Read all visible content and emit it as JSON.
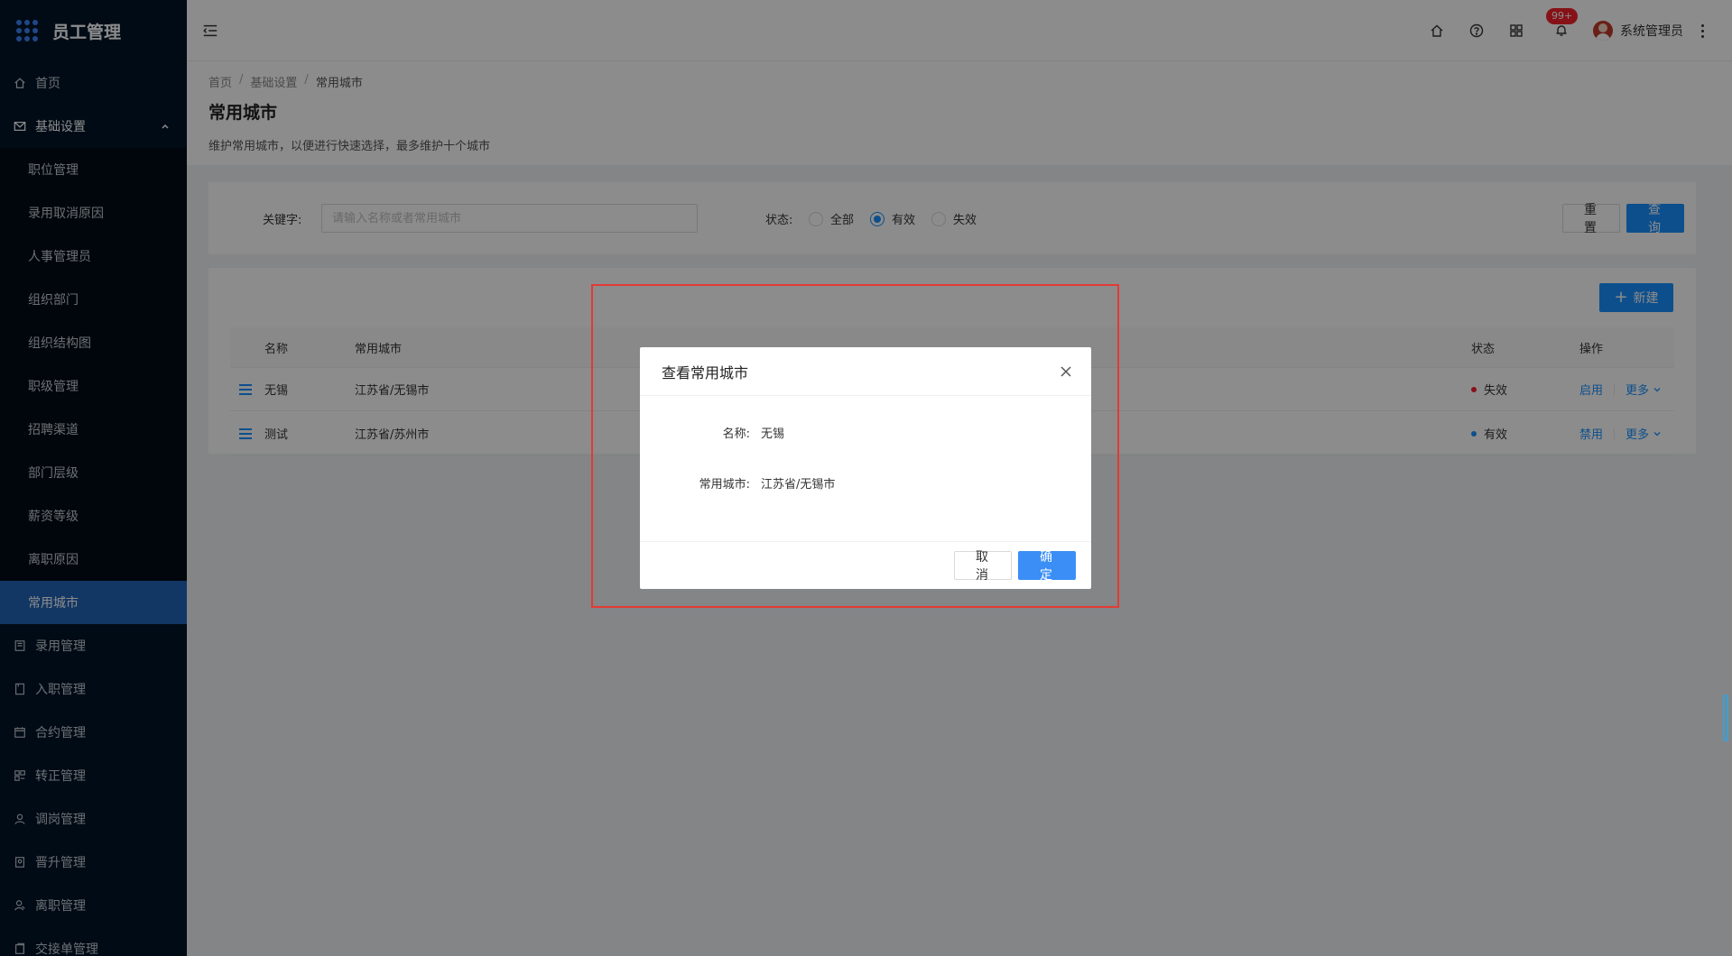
{
  "app": {
    "title": "员工管理"
  },
  "sidebar": {
    "home": "首页",
    "basic_settings": "基础设置",
    "sub_items": [
      "职位管理",
      "录用取消原因",
      "人事管理员",
      "组织部门",
      "组织结构图",
      "职级管理",
      "招聘渠道",
      "部门层级",
      "薪资等级",
      "离职原因",
      "常用城市"
    ],
    "active_sub": "常用城市",
    "bottom_items": [
      "录用管理",
      "入职管理",
      "合约管理",
      "转正管理",
      "调岗管理",
      "晋升管理",
      "离职管理",
      "交接单管理"
    ]
  },
  "header": {
    "notification_badge": "99+",
    "user_name": "系统管理员"
  },
  "breadcrumb": [
    "首页",
    "基础设置",
    "常用城市"
  ],
  "page": {
    "title": "常用城市",
    "description": "维护常用城市，以便进行快速选择，最多维护十个城市"
  },
  "filter": {
    "keyword_label": "关键字:",
    "keyword_placeholder": "请输入名称或者常用城市",
    "keyword_value": "",
    "status_label": "状态:",
    "status_options": [
      "全部",
      "有效",
      "失效"
    ],
    "status_selected": "有效",
    "reset_label": "重置",
    "query_label": "查询"
  },
  "table": {
    "new_label": "新建",
    "columns": [
      "名称",
      "常用城市",
      "状态",
      "操作"
    ],
    "rows": [
      {
        "name": "无锡",
        "city": "江苏省/无锡市",
        "status": "失效",
        "status_color": "#f5222d",
        "op": "启用",
        "more": "更多"
      },
      {
        "name": "测试",
        "city": "江苏省/苏州市",
        "status": "有效",
        "status_color": "#1890ff",
        "op": "禁用",
        "more": "更多"
      }
    ]
  },
  "modal": {
    "title": "查看常用城市",
    "name_label": "名称:",
    "name_value": "无锡",
    "city_label": "常用城市:",
    "city_value": "江苏省/无锡市",
    "cancel_label": "取消",
    "ok_label": "确定"
  },
  "colors": {
    "sidebar_bg": "#001529",
    "active_item": "#2264b8",
    "primary": "#1890ff",
    "highlight": "#e53935"
  }
}
